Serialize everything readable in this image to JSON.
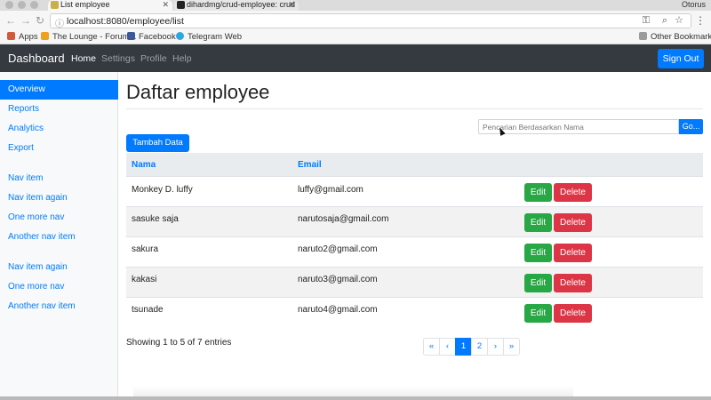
{
  "browser": {
    "tabs": [
      {
        "title": "List employee",
        "favicon_color": "#c8b04a"
      },
      {
        "title": "dihardmg/crud-employee: crud",
        "favicon_color": "#222222"
      }
    ],
    "profile": "Otorus",
    "url": "localhost:8080/employee/list",
    "bookmarks": [
      {
        "label": "Apps",
        "icon": "apps-grid-icon",
        "color": "#d05a3a"
      },
      {
        "label": "The Lounge - Forum...",
        "icon": "lounge-icon",
        "color": "#f0a020"
      },
      {
        "label": "Facebook",
        "icon": "facebook-icon",
        "color": "#3b5998"
      },
      {
        "label": "Telegram Web",
        "icon": "telegram-icon",
        "color": "#2ca5e0"
      }
    ],
    "other_bookmarks": "Other Bookmarks"
  },
  "navbar": {
    "brand": "Dashboard",
    "links": [
      "Home",
      "Settings",
      "Profile",
      "Help"
    ],
    "active_link": "Home",
    "signout": "Sign Out"
  },
  "sidebar": {
    "items": [
      "Overview",
      "Reports",
      "Analytics",
      "Export",
      "Nav item",
      "Nav item again",
      "One more nav",
      "Another nav item",
      "Nav item again",
      "One more nav",
      "Another nav item"
    ],
    "active_item": "Overview"
  },
  "main": {
    "title": "Daftar employee",
    "search_placeholder": "Pencarian Berdasarkan Nama",
    "go_label": "Go...",
    "add_label": "Tambah Data",
    "columns": [
      "Nama",
      "Email"
    ],
    "rows": [
      {
        "nama": "Monkey D. luffy",
        "email": "luffy@gmail.com"
      },
      {
        "nama": "sasuke saja",
        "email": "narutosaja@gmail.com"
      },
      {
        "nama": "sakura",
        "email": "naruto2@gmail.com"
      },
      {
        "nama": "kakasi",
        "email": "naruto3@gmail.com"
      },
      {
        "nama": "tsunade",
        "email": "naruto4@gmail.com"
      }
    ],
    "edit_label": "Edit",
    "delete_label": "Delete",
    "showing": "Showing 1 to 5 of 7 entries",
    "pagination": [
      "«",
      "‹",
      "1",
      "2",
      "›",
      "»"
    ],
    "active_page": "1"
  },
  "colors": {
    "primary": "#007bff",
    "success": "#28a745",
    "danger": "#dc3545",
    "navbar_bg": "#343a40"
  }
}
